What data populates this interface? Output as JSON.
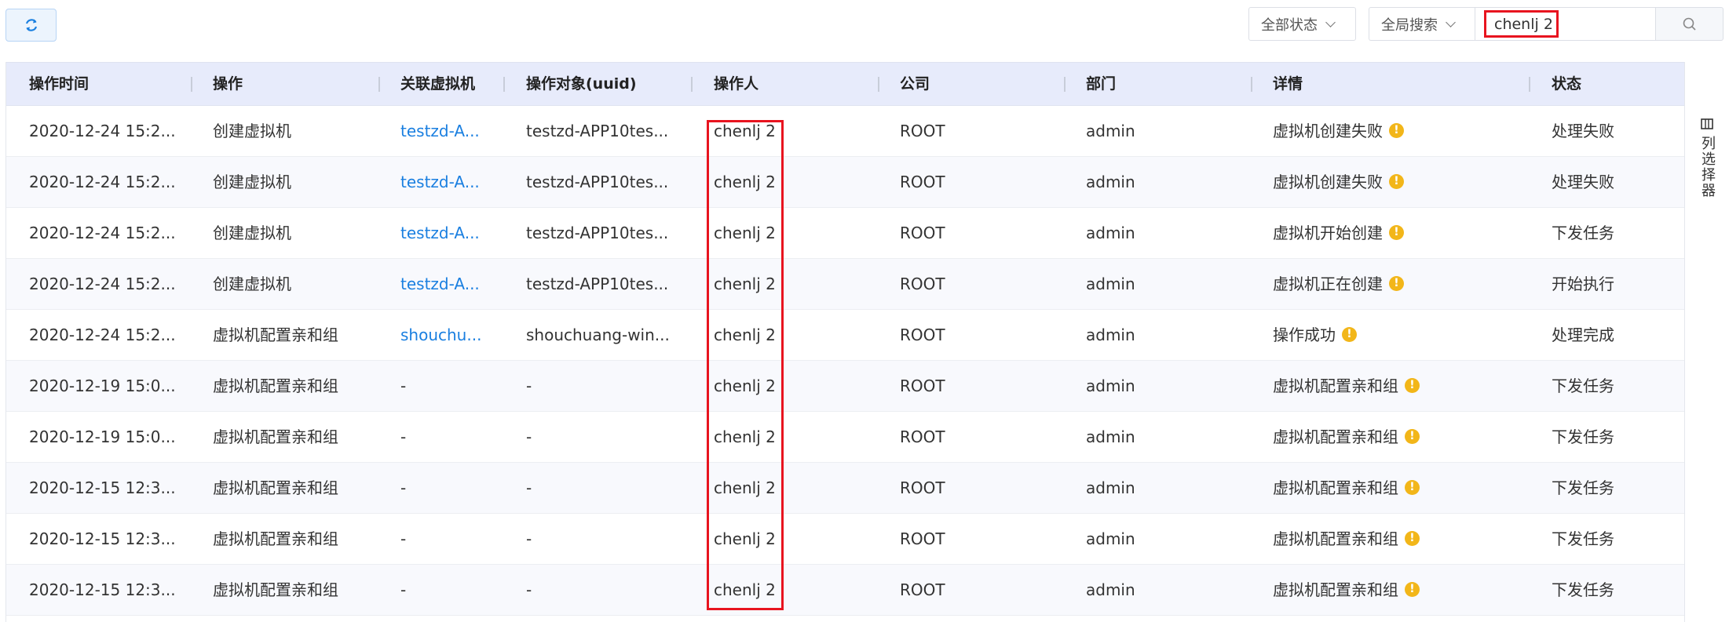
{
  "toolbar": {
    "refresh_icon": "refresh-icon",
    "status_filter": "全部状态",
    "search_scope": "全局搜索",
    "search_value": "chenlj 2",
    "search_icon": "search-icon"
  },
  "table": {
    "columns": [
      "操作时间",
      "操作",
      "关联虚拟机",
      "操作对象(uuid)",
      "操作人",
      "公司",
      "部门",
      "详情",
      "状态"
    ],
    "rows": [
      {
        "time": "2020-12-24 15:2...",
        "action": "创建虚拟机",
        "vm": "testzd-A...",
        "target": "testzd-APP10tes...",
        "operator": "chenlj 2",
        "company": "ROOT",
        "dept": "admin",
        "detail": "虚拟机创建失败",
        "status": "处理失败"
      },
      {
        "time": "2020-12-24 15:2...",
        "action": "创建虚拟机",
        "vm": "testzd-A...",
        "target": "testzd-APP10tes...",
        "operator": "chenlj 2",
        "company": "ROOT",
        "dept": "admin",
        "detail": "虚拟机创建失败",
        "status": "处理失败"
      },
      {
        "time": "2020-12-24 15:2...",
        "action": "创建虚拟机",
        "vm": "testzd-A...",
        "target": "testzd-APP10tes...",
        "operator": "chenlj 2",
        "company": "ROOT",
        "dept": "admin",
        "detail": "虚拟机开始创建",
        "status": "下发任务"
      },
      {
        "time": "2020-12-24 15:2...",
        "action": "创建虚拟机",
        "vm": "testzd-A...",
        "target": "testzd-APP10tes...",
        "operator": "chenlj 2",
        "company": "ROOT",
        "dept": "admin",
        "detail": "虚拟机正在创建",
        "status": "开始执行"
      },
      {
        "time": "2020-12-24 15:2...",
        "action": "虚拟机配置亲和组",
        "vm": "shouchu...",
        "target": "shouchuang-win...",
        "operator": "chenlj 2",
        "company": "ROOT",
        "dept": "admin",
        "detail": "操作成功",
        "status": "处理完成"
      },
      {
        "time": "2020-12-19 15:0...",
        "action": "虚拟机配置亲和组",
        "vm": "-",
        "target": "-",
        "operator": "chenlj 2",
        "company": "ROOT",
        "dept": "admin",
        "detail": "虚拟机配置亲和组",
        "status": "下发任务"
      },
      {
        "time": "2020-12-19 15:0...",
        "action": "虚拟机配置亲和组",
        "vm": "-",
        "target": "-",
        "operator": "chenlj 2",
        "company": "ROOT",
        "dept": "admin",
        "detail": "虚拟机配置亲和组",
        "status": "下发任务"
      },
      {
        "time": "2020-12-15 12:3...",
        "action": "虚拟机配置亲和组",
        "vm": "-",
        "target": "-",
        "operator": "chenlj 2",
        "company": "ROOT",
        "dept": "admin",
        "detail": "虚拟机配置亲和组",
        "status": "下发任务"
      },
      {
        "time": "2020-12-15 12:3...",
        "action": "虚拟机配置亲和组",
        "vm": "-",
        "target": "-",
        "operator": "chenlj 2",
        "company": "ROOT",
        "dept": "admin",
        "detail": "虚拟机配置亲和组",
        "status": "下发任务"
      },
      {
        "time": "2020-12-15 12:3...",
        "action": "虚拟机配置亲和组",
        "vm": "-",
        "target": "-",
        "operator": "chenlj 2",
        "company": "ROOT",
        "dept": "admin",
        "detail": "虚拟机配置亲和组",
        "status": "下发任务"
      }
    ]
  },
  "side_panel": {
    "column_selector_label": "列选择器",
    "column_selector_icon": "columns-icon"
  },
  "colors": {
    "accent": "#1a7fe0",
    "header_bg": "#e7ebfb",
    "warn": "#f2b619",
    "highlight": "#e8141f"
  }
}
